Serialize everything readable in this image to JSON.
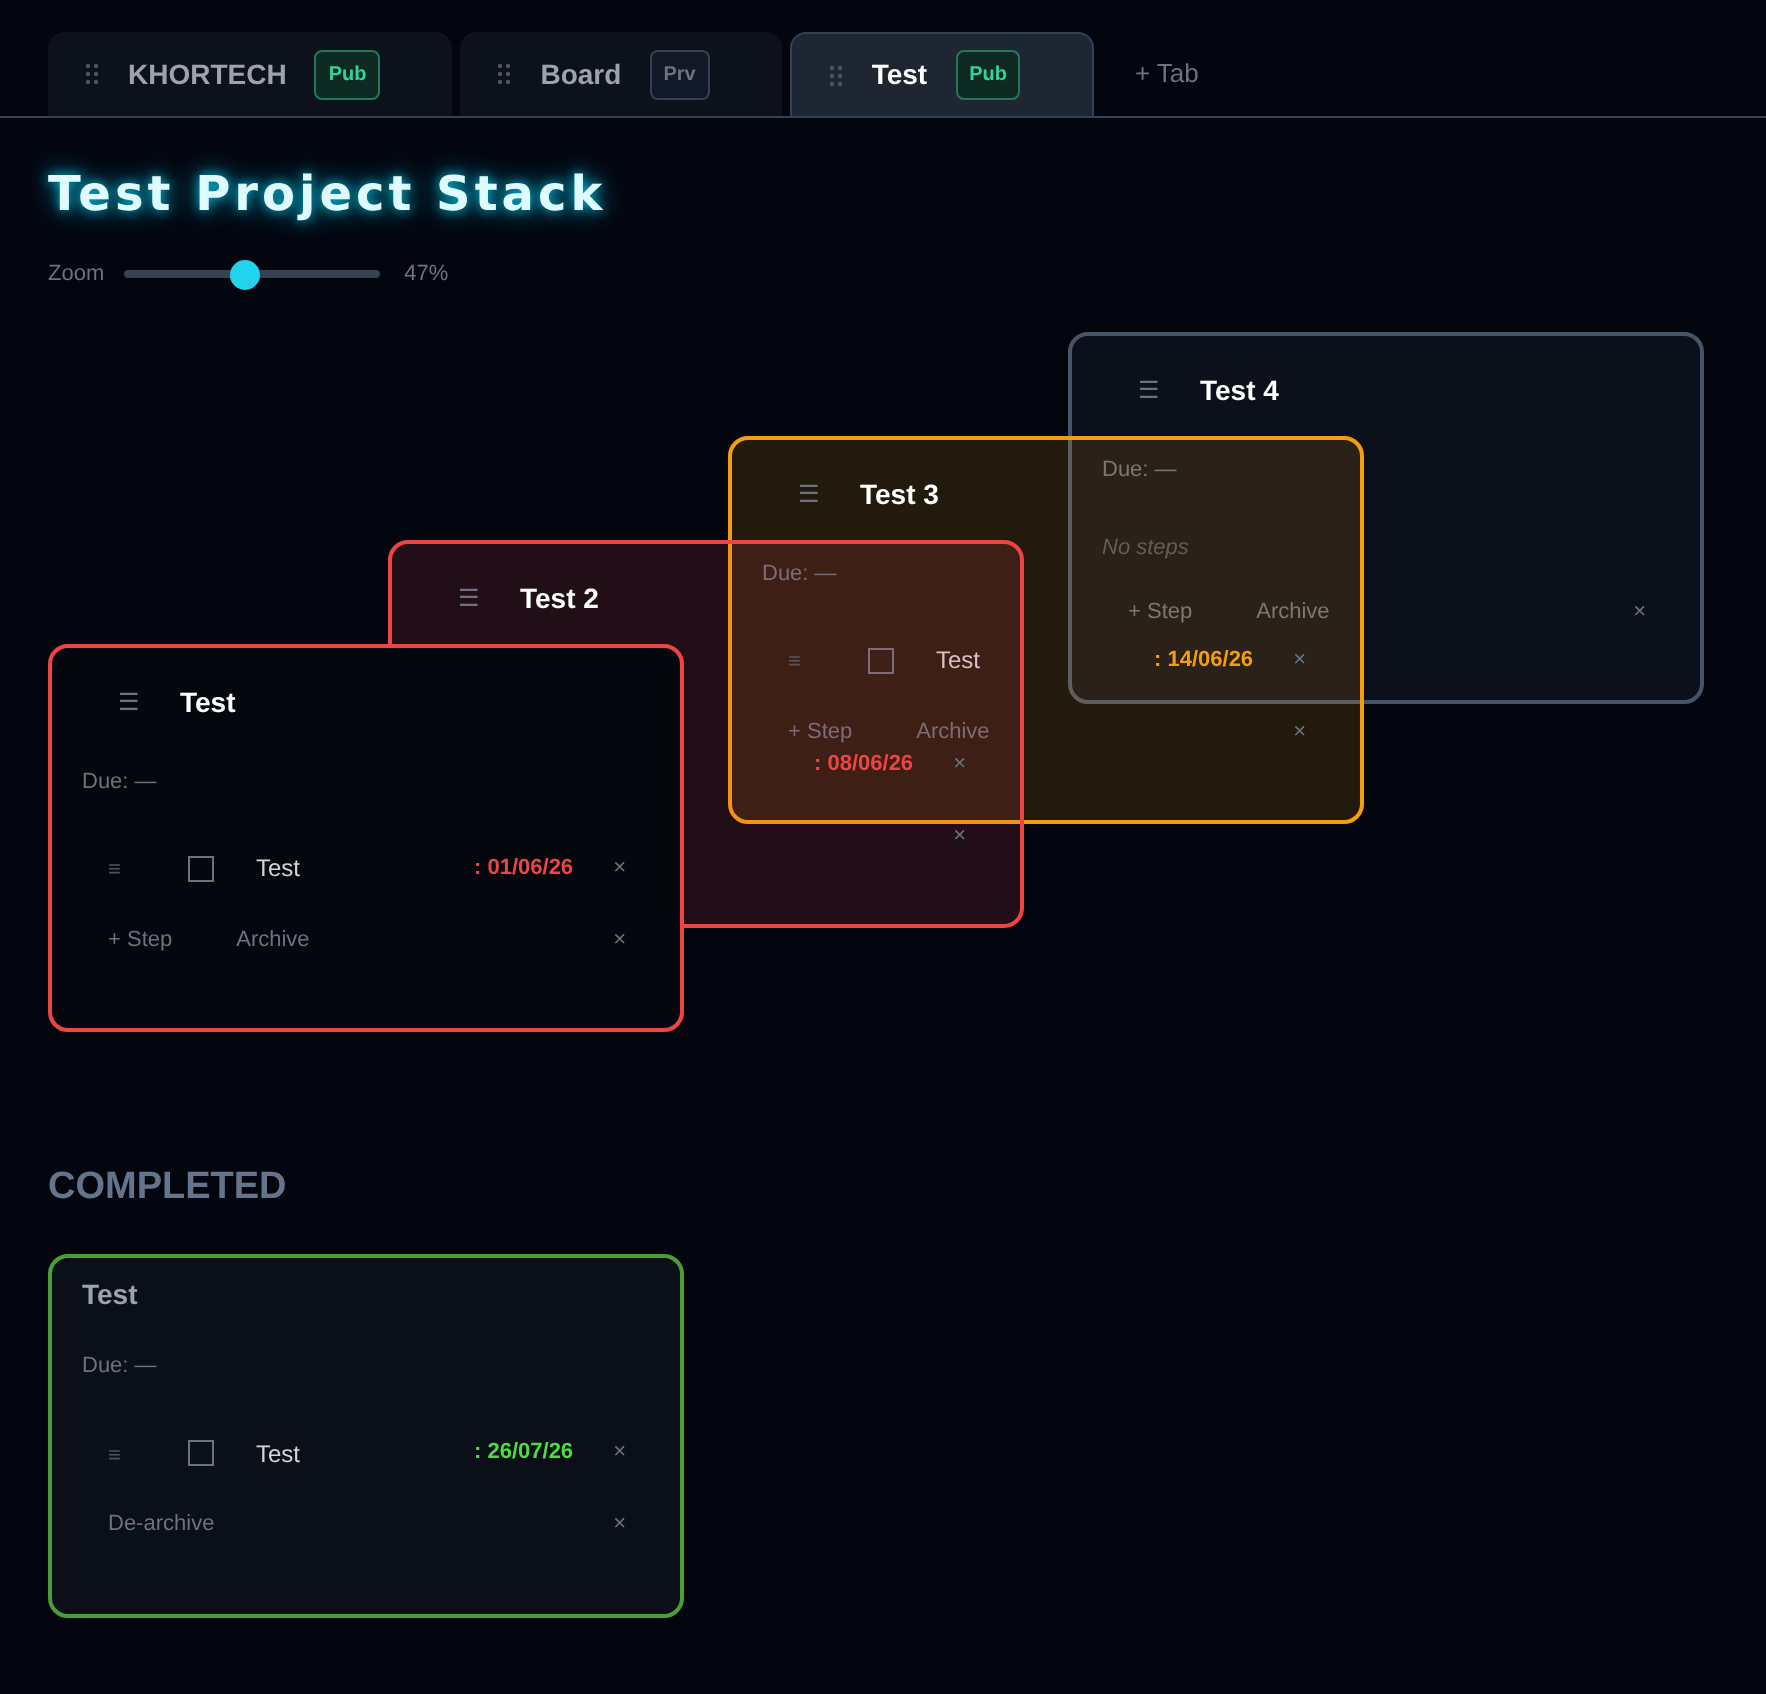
{
  "tabs": [
    {
      "label": "KHORTECH",
      "selected": false,
      "badge": {
        "text": "Pub",
        "kind": "public"
      }
    },
    {
      "label": "Board",
      "selected": false,
      "badge": {
        "text": "Prv",
        "kind": "private"
      }
    },
    {
      "label": "Test",
      "selected": true,
      "badge": {
        "text": "Pub",
        "kind": "public"
      }
    }
  ],
  "add_tab": "+ Tab",
  "title": "Test Project Stack",
  "zoom": {
    "label": "Zoom",
    "level": 0.47,
    "reading": "47%"
  },
  "stack": [
    {
      "menu": "☰",
      "title": "Test",
      "color": "#ef4444",
      "due": "Due: —",
      "steps": [
        {
          "handle": "≡",
          "checked": false,
          "name": "Test",
          "date": ": 01/06/26",
          "color": "#ef4444",
          "remove": "×"
        }
      ],
      "footer": {
        "add": "+ Step",
        "archive": "Archive",
        "close": "×"
      }
    },
    {
      "menu": "☰",
      "title": "Test 2",
      "color": "#ef4444",
      "steps": [
        {
          "date": ": 08/06/26",
          "color": "#ef4444",
          "remove": "×"
        }
      ],
      "footer": {
        "close": "×"
      }
    },
    {
      "menu": "☰",
      "title": "Test 3",
      "color": "#f59e0b",
      "due": "Due: —",
      "steps": [
        {
          "handle": "≡",
          "checked": false,
          "name": "Test",
          "date": ": 14/06/26",
          "color": "#f59e0b",
          "remove": "×"
        }
      ],
      "footer": {
        "add": "+ Step",
        "archive": "Archive",
        "close": "×"
      }
    },
    {
      "menu": "☰",
      "title": "Test 4",
      "color": "#475569",
      "due": "Due: —",
      "empty": "No steps",
      "footer": {
        "add": "+ Step",
        "archive": "Archive",
        "close": "×"
      }
    }
  ],
  "completed": {
    "heading": "COMPLETED",
    "cards": [
      {
        "title": "Test",
        "color": "#4a9e36",
        "due": "Due: —",
        "steps": [
          {
            "handle": "≡",
            "checked": false,
            "name": "Test",
            "date": ": 26/07/26",
            "color": "#4ade40",
            "remove": "×"
          }
        ],
        "footer": {
          "dearchive": "De-archive",
          "close": "×"
        }
      }
    ]
  }
}
